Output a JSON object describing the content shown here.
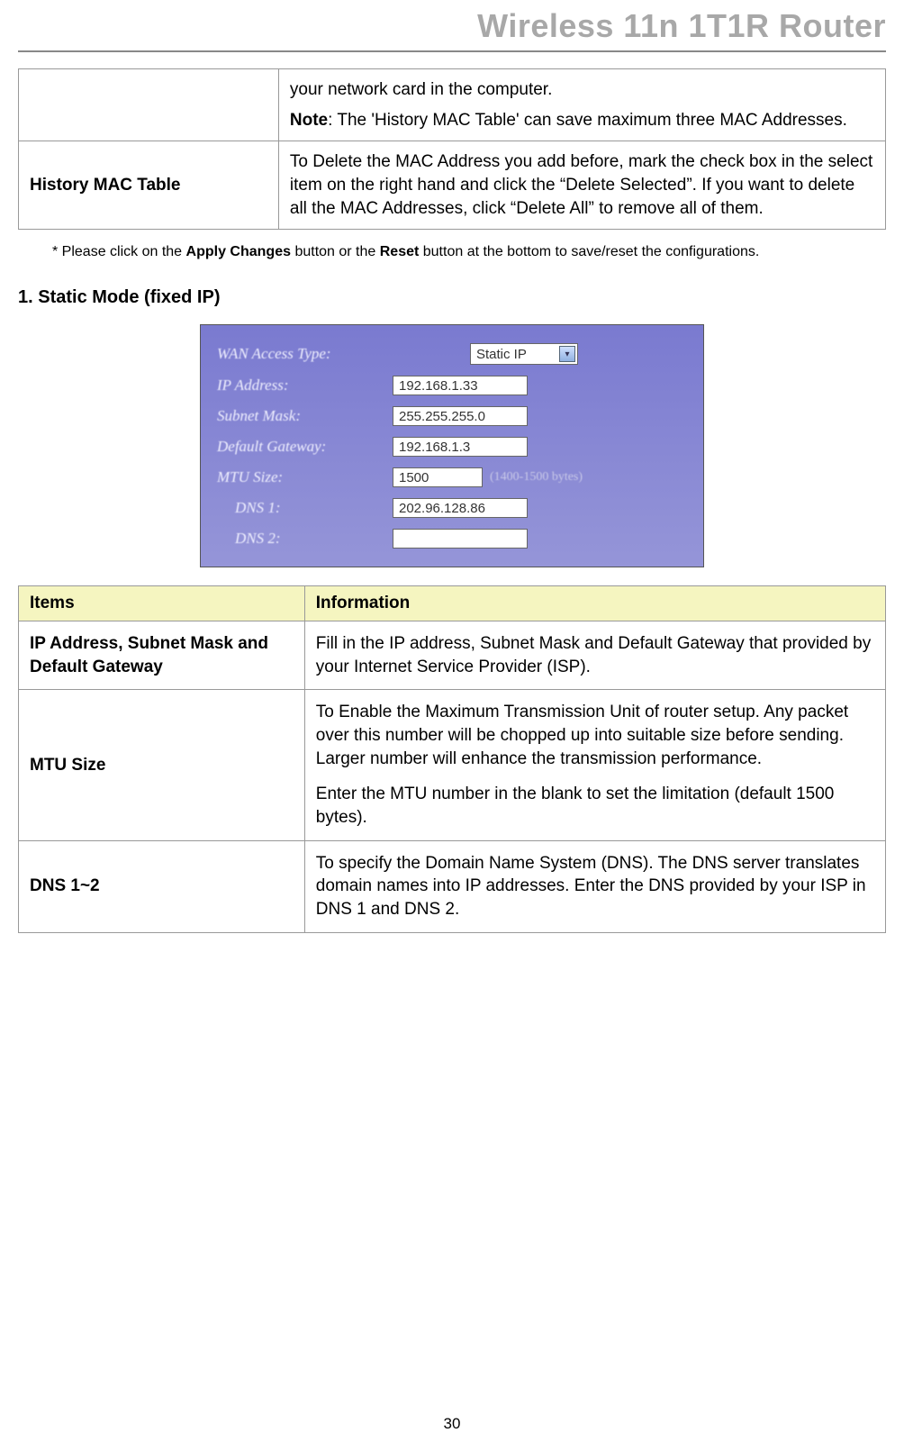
{
  "header": {
    "title": "Wireless 11n 1T1R Router"
  },
  "top_table": {
    "row1": {
      "label": "",
      "desc_line1": "your network card in the computer.",
      "note_prefix": "Note",
      "note_text": ": The 'History MAC Table' can save maximum three MAC Addresses."
    },
    "row2": {
      "label": "History MAC Table",
      "desc": "To Delete the MAC Address you add before, mark the check box in the select item on the right hand and click the “Delete Selected”. If you want to delete all the MAC Addresses, click “Delete All” to remove all of them."
    }
  },
  "footnote": {
    "prefix": "* Please click on the ",
    "b1": "Apply Changes",
    "mid": " button or the ",
    "b2": "Reset",
    "suffix": " button at the bottom to save/reset the configurations."
  },
  "section_heading": "1. Static Mode (fixed IP)",
  "screenshot": {
    "wan_label": "WAN Access Type:",
    "wan_value": "Static IP",
    "ip_label": "IP Address:",
    "ip_value": "192.168.1.33",
    "subnet_label": "Subnet Mask:",
    "subnet_value": "255.255.255.0",
    "gw_label": "Default Gateway:",
    "gw_value": "192.168.1.3",
    "mtu_label": "MTU Size:",
    "mtu_value": "1500",
    "mtu_hint": "(1400-1500 bytes)",
    "dns1_label": "DNS 1:",
    "dns1_value": "202.96.128.86",
    "dns2_label": "DNS 2:",
    "dns2_value": ""
  },
  "items_table": {
    "header_items": "Items",
    "header_info": "Information",
    "rows": [
      {
        "item": "IP Address, Subnet Mask and Default Gateway",
        "info": "Fill in the IP address, Subnet Mask and Default Gateway that provided by your Internet Service Provider (ISP)."
      },
      {
        "item": "MTU Size",
        "info_p1": "To Enable the Maximum Transmission Unit of router setup. Any packet over this number will be chopped up into suitable size before sending. Larger number will enhance the transmission performance.",
        "info_p2": "Enter the MTU number in the blank to set the limitation (default 1500 bytes)."
      },
      {
        "item": "DNS 1~2",
        "info": "To specify the Domain Name System (DNS). The DNS server translates domain names into IP addresses. Enter the DNS provided by your ISP in DNS 1 and DNS 2."
      }
    ]
  },
  "page_number": "30"
}
